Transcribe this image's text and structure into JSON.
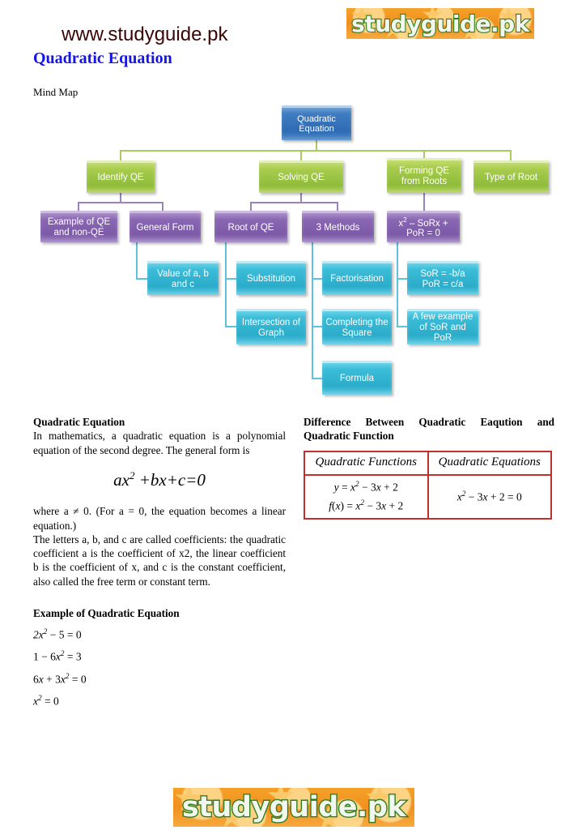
{
  "header": {
    "site_url": "www.studyguide.pk",
    "page_title": "Quadratic Equation",
    "mindmap_label": "Mind Map",
    "logo_text": "studyguide.pk"
  },
  "footer": {
    "logo_text": "studyguide.pk"
  },
  "colors": {
    "site_url": "#3a0505",
    "page_title": "#1414e6",
    "logo_bg": "#f09020",
    "logo_text": "#f2f7ee",
    "logo_outline": "#2f7d21",
    "node_root": "#2f6bb4",
    "node_level1": "#8fbc3b",
    "node_level2": "#7d5aa8",
    "node_level3": "#2bacca",
    "table_border": "#c0302c"
  },
  "mindmap": {
    "root": {
      "label": "Quadratic Equation"
    },
    "level1": [
      {
        "label": "Identify QE"
      },
      {
        "label": "Solving QE"
      },
      {
        "label": "Forming QE from Roots"
      },
      {
        "label": "Type of Root"
      }
    ],
    "level2": [
      {
        "label": "Example of QE and non-QE"
      },
      {
        "label": "General Form"
      },
      {
        "label": "Root of QE"
      },
      {
        "label": "3 Methods"
      },
      {
        "label": "x2 – SoRx + PoR = 0",
        "label_base": "x",
        "label_sup": "2",
        "label_rest": " – SoRx + PoR = 0"
      }
    ],
    "level3": [
      {
        "label": "Value of a, b and c"
      },
      {
        "label": "Substitution"
      },
      {
        "label": "Intersection of Graph"
      },
      {
        "label": "Factorisation"
      },
      {
        "label": "Completing the Square"
      },
      {
        "label": "Formula"
      },
      {
        "label": "SoR = -b/a PoR = c/a",
        "line1": "SoR = -b/a",
        "line2": "PoR = c/a"
      },
      {
        "label": "A few example of SoR and PoR"
      }
    ]
  },
  "content": {
    "left": {
      "heading": "Quadratic Equation",
      "para1": "In mathematics, a quadratic equation is a polynomial equation of the second degree. The general form is",
      "formula": "ax2 +bx+c=0",
      "para2": "where a ≠ 0. (For a = 0, the equation becomes a linear equation.)",
      "para3": "The letters a, b, and c are called coefficients: the quadratic coefficient a is the coefficient of x2, the linear coefficient b is the coefficient of x, and c is the constant coefficient, also called the free term or constant term.",
      "examples_heading": "Example of Quadratic Equation",
      "examples": [
        "2x2 − 5 = 0",
        "1 − 6x2 = 3",
        "6x + 3x2 = 0",
        "x2 = 0"
      ]
    },
    "right": {
      "heading": "Difference Between Quadratic Eaqution and Quadratic Function",
      "table": {
        "headers": [
          "Quadratic Functions",
          "Quadratic Equations"
        ],
        "col1_rows": [
          "y = x2 − 3x + 2",
          "f(x) = x2 − 3x + 2"
        ],
        "col2_rows": [
          "x2 − 3x + 2 = 0"
        ]
      }
    }
  }
}
